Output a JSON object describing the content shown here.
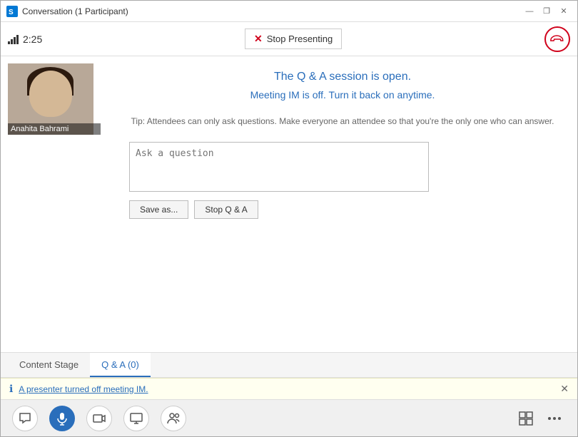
{
  "window": {
    "title": "Conversation (1 Participant)",
    "controls": {
      "minimize": "—",
      "restore": "❐",
      "close": "✕"
    }
  },
  "toolbar": {
    "time": "2:25",
    "stop_presenting_label": "Stop Presenting",
    "end_call_tooltip": "End call"
  },
  "avatar": {
    "name": "Anahita Bahrami"
  },
  "main": {
    "qa_open_text": "The Q & A session is open.",
    "im_off_text": "Meeting IM is off. Turn it back on anytime.",
    "tip_text": "Tip: Attendees can only ask questions. Make everyone an attendee so that you're the only one who can answer.",
    "question_placeholder": "Ask a question",
    "save_label": "Save as...",
    "stop_qa_label": "Stop Q & A"
  },
  "tabs": [
    {
      "id": "content-stage",
      "label": "Content Stage",
      "active": false
    },
    {
      "id": "qa",
      "label": "Q & A (0)",
      "active": true
    }
  ],
  "info_bar": {
    "message": "A presenter turned off meeting IM.",
    "close": "✕"
  },
  "bottom_bar": {
    "buttons": [
      {
        "icon": "💬",
        "name": "chat",
        "active": false
      },
      {
        "icon": "🎤",
        "name": "audio",
        "active": true
      },
      {
        "icon": "📹",
        "name": "video",
        "active": false
      },
      {
        "icon": "🖥️",
        "name": "screen-share",
        "active": false
      },
      {
        "icon": "👥",
        "name": "participants",
        "active": false
      }
    ],
    "right_buttons": [
      {
        "icon": "⊞",
        "name": "layout"
      },
      {
        "icon": "···",
        "name": "more"
      }
    ]
  }
}
